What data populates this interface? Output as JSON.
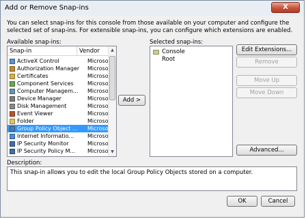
{
  "window": {
    "title": "Add or Remove Snap-ins",
    "close_glyph": "X"
  },
  "intro_text": "You can select snap-ins for this console from those available on your computer and configure the selected set of snap-ins. For extensible snap-ins, you can configure which extensions are enabled.",
  "available": {
    "label": "Available snap-ins:",
    "columns": {
      "snapin": "Snap-in",
      "vendor": "Vendor"
    },
    "items": [
      {
        "name": "ActiveX Control",
        "vendor": "Microsoft Cor...",
        "icon": "activex-icon",
        "color": "#5b8fd6"
      },
      {
        "name": "Authorization Manager",
        "vendor": "Microsoft Cor...",
        "icon": "authorization-icon",
        "color": "#c08a2e"
      },
      {
        "name": "Certificates",
        "vendor": "Microsoft Cor...",
        "icon": "certificate-icon",
        "color": "#d9b04a"
      },
      {
        "name": "Component Services",
        "vendor": "Microsoft Cor...",
        "icon": "component-icon",
        "color": "#6aa84f"
      },
      {
        "name": "Computer Managem...",
        "vendor": "Microsoft Cor...",
        "icon": "computer-icon",
        "color": "#6f8fb5"
      },
      {
        "name": "Device Manager",
        "vendor": "Microsoft Cor...",
        "icon": "device-icon",
        "color": "#7d7d7d"
      },
      {
        "name": "Disk Management",
        "vendor": "Microsoft and...",
        "icon": "disk-icon",
        "color": "#8a8a8a"
      },
      {
        "name": "Event Viewer",
        "vendor": "Microsoft Cor...",
        "icon": "event-icon",
        "color": "#b9542e"
      },
      {
        "name": "Folder",
        "vendor": "Microsoft Cor...",
        "icon": "folder-icon",
        "color": "#e3c45b"
      },
      {
        "name": "Group Policy Object ...",
        "vendor": "Microsoft Cor...",
        "icon": "policy-icon",
        "color": "#4a7bbf",
        "selected": true
      },
      {
        "name": "Internet Informatio...",
        "vendor": "Microsoft Cor...",
        "icon": "iis-icon",
        "color": "#4c8ed9"
      },
      {
        "name": "IP Security Monitor",
        "vendor": "Microsoft Cor...",
        "icon": "ipsec-monitor-icon",
        "color": "#3f6fa6"
      },
      {
        "name": "IP Security Policy M...",
        "vendor": "Microsoft Cor...",
        "icon": "ipsec-policy-icon",
        "color": "#3f6fa6"
      }
    ]
  },
  "add_button": "Add >",
  "selected": {
    "label": "Selected snap-ins:",
    "items": [
      {
        "name": "Console Root",
        "icon": "folder-icon"
      }
    ]
  },
  "side_buttons": {
    "edit_extensions": "Edit Extensions...",
    "remove": "Remove",
    "move_up": "Move Up",
    "move_down": "Move Down",
    "advanced": "Advanced..."
  },
  "description": {
    "label": "Description:",
    "text": "This snap-in allows you to edit the local Group Policy Objects stored on a computer."
  },
  "footer": {
    "ok": "OK",
    "cancel": "Cancel"
  }
}
